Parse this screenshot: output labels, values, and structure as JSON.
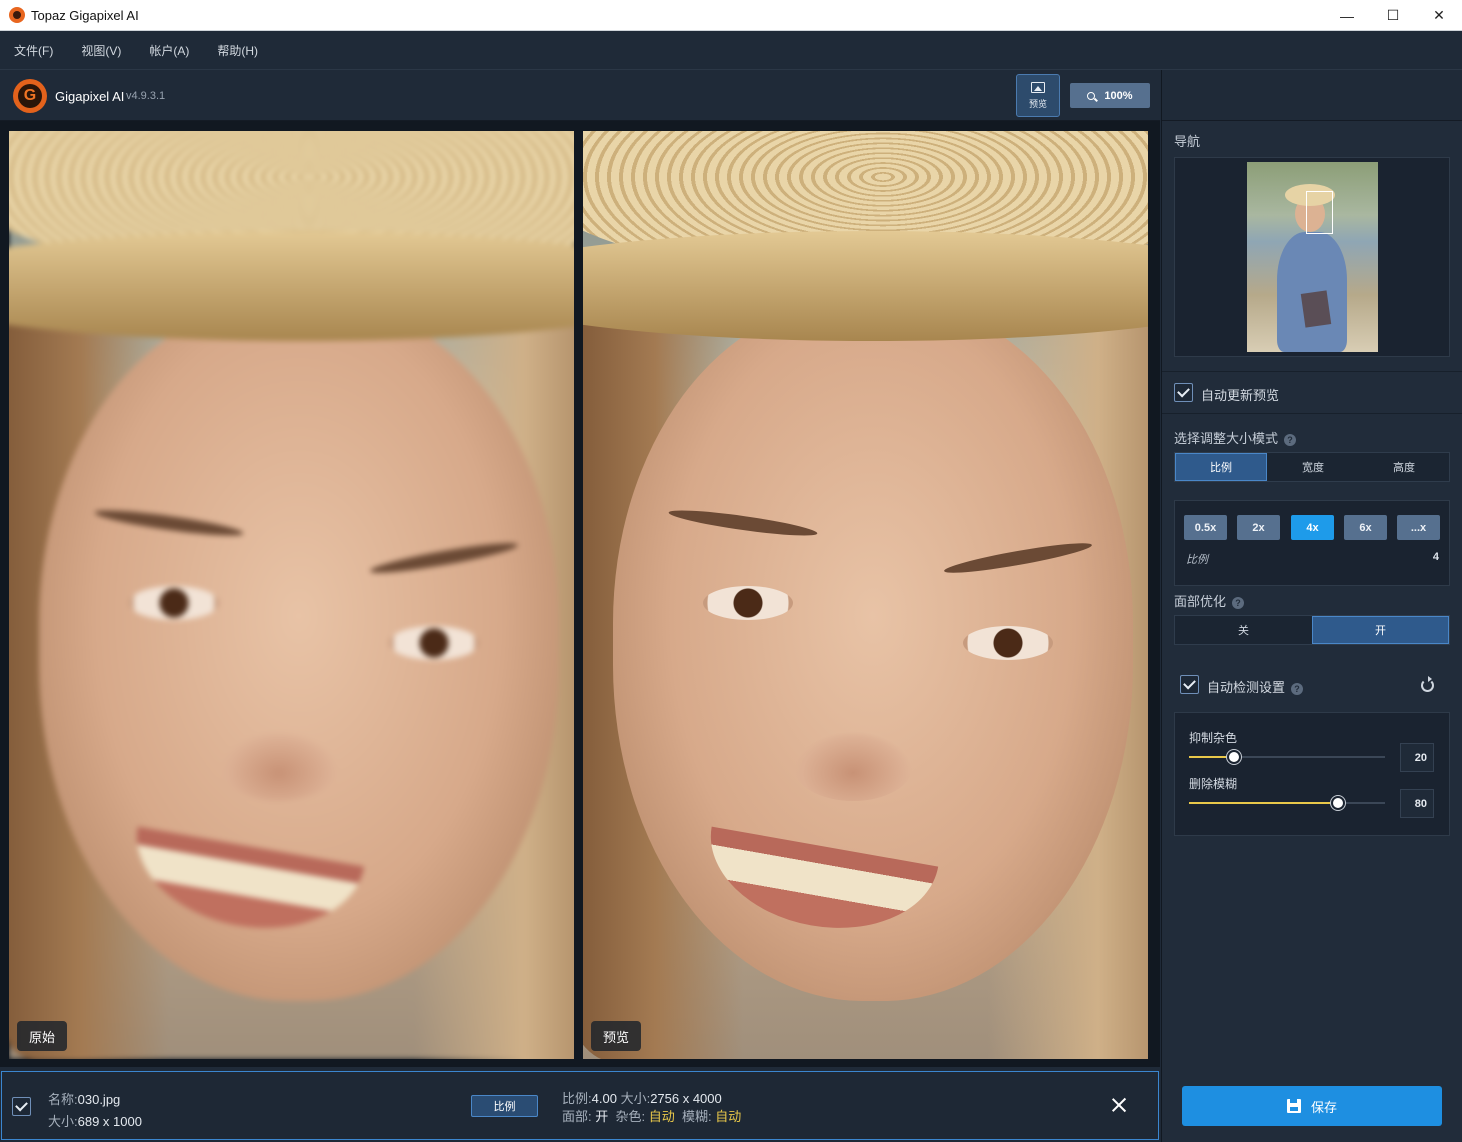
{
  "window": {
    "title": "Topaz Gigapixel AI",
    "controls": {
      "minimize": "—",
      "maximize": "☐",
      "close": "✕"
    }
  },
  "menu": [
    "文件(F)",
    "视图(V)",
    "帐户(A)",
    "帮助(H)"
  ],
  "toolbar": {
    "app_name": "Gigapixel AI",
    "version": "v4.9.3.1",
    "preview_label": "预览",
    "zoom_label": "100%"
  },
  "canvas": {
    "original_label": "原始",
    "preview_label": "预览"
  },
  "panel": {
    "navigation_title": "导航",
    "auto_update_label": "自动更新预览",
    "auto_update_checked": true,
    "resize_mode_title": "选择调整大小模式",
    "resize_modes": [
      "比例",
      "宽度",
      "高度"
    ],
    "resize_mode_selected": "比例",
    "scale_options": [
      "0.5x",
      "2x",
      "4x",
      "6x",
      "...x"
    ],
    "scale_selected": "4x",
    "scale_label": "比例",
    "scale_value": "4",
    "face_refine_title": "面部优化",
    "face_refine_options": [
      "关",
      "开"
    ],
    "face_refine_selected": "开",
    "auto_detect_label": "自动检测设置",
    "auto_detect_checked": true,
    "suppress_noise_label": "抑制杂色",
    "suppress_noise_value": "20",
    "remove_blur_label": "删除模糊",
    "remove_blur_value": "80",
    "save_label": "保存"
  },
  "sliders": {
    "suppress_noise": 0.23,
    "remove_blur": 0.76
  },
  "file": {
    "name_label": "名称:",
    "name": "030.jpg",
    "size_label": "大小:",
    "size": "689 x 1000",
    "mode_button": "比例",
    "scale_label": "比例:",
    "scale": "4.00",
    "out_size_label": "大小:",
    "out_size": "2756 x 4000",
    "face_label": "面部:",
    "face_value": "开",
    "noise_label": "杂色:",
    "noise_value": "自动",
    "blur_label": "模糊:",
    "blur_value": "自动"
  },
  "colors": {
    "accent": "#1e8fe1",
    "active_scale": "#1e9bea",
    "slider_fill": "#e9c84a",
    "highlight_text": "#e9c84a"
  }
}
